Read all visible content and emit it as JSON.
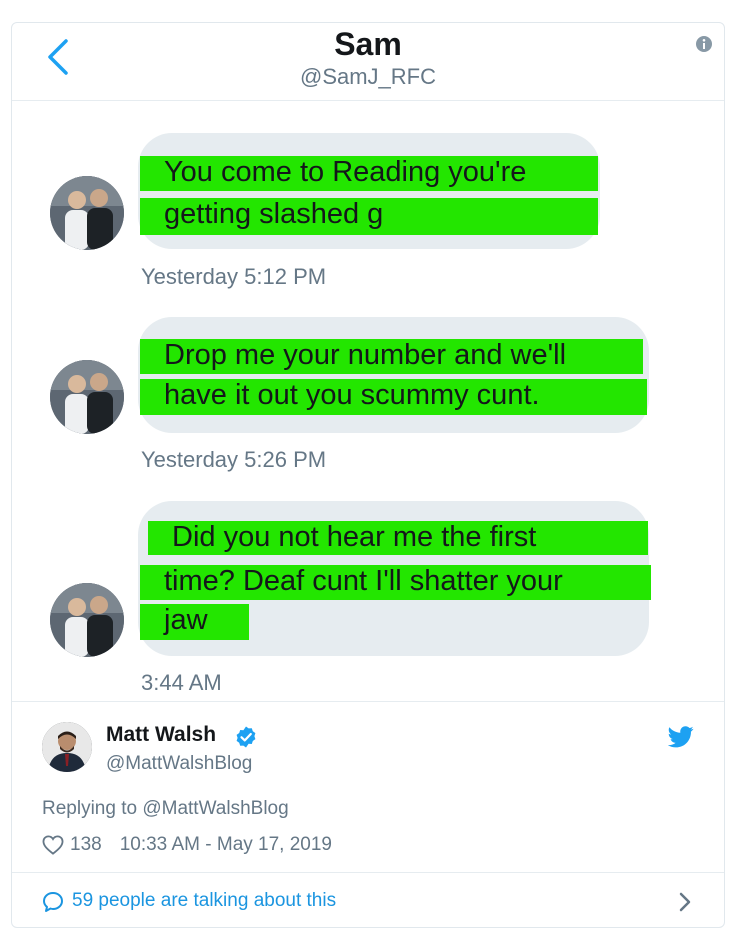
{
  "dm_header": {
    "name": "Sam",
    "handle": "@SamJ_RFC",
    "back_icon": "chevron-left-icon",
    "info_icon": "info-icon"
  },
  "messages": [
    {
      "lines": [
        "You come to Reading you're",
        "getting slashed g"
      ],
      "timestamp": "Yesterday 5:12 PM"
    },
    {
      "lines": [
        "Drop me your number and we'll",
        "have it out you scummy  cunt."
      ],
      "timestamp": "Yesterday 5:26 PM"
    },
    {
      "lines": [
        "Did you not hear me the first",
        "time? Deaf cunt I'll shatter your",
        "jaw"
      ],
      "timestamp": "3:44 AM"
    }
  ],
  "tweet": {
    "author_name": "Matt Walsh",
    "author_handle": "@MattWalshBlog",
    "verified": true,
    "replying_to": "Replying to @MattWalshBlog",
    "likes": "138",
    "datetime": "10:33 AM - May 17, 2019",
    "talking": "59 people are talking about this"
  },
  "colors": {
    "highlight": "#23e600",
    "bubble": "#e6ecf0",
    "twitter_blue": "#1da1f2",
    "link_blue": "#1b95e0",
    "muted_text": "#657786"
  }
}
